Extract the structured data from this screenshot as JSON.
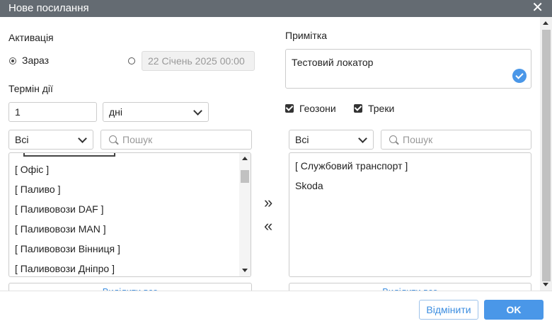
{
  "dialog": {
    "title": "Нове посилання",
    "close_glyph": "✕"
  },
  "activation": {
    "label": "Активація",
    "now_label": "Зараз",
    "date_value": "22 Січень 2025 00:00"
  },
  "term": {
    "label": "Термін дії",
    "value": "1",
    "unit": "дні"
  },
  "note": {
    "label": "Примітка",
    "value": "Тестовий локатор"
  },
  "options": {
    "geozones_label": "Геозони",
    "geozones_checked": true,
    "tracks_label": "Треки",
    "tracks_checked": true
  },
  "left_panel": {
    "filter": "Всі",
    "search_placeholder": "Пошук",
    "items": [
      "[ Офіс ]",
      "[ Паливо ]",
      "[ Паливовози DAF ]",
      "[ Паливовози MAN ]",
      "[ Паливовози Вінниця ]",
      "[ Паливовози Дніпро ]"
    ],
    "select_all": "Виділити все"
  },
  "right_panel": {
    "filter": "Всі",
    "search_placeholder": "Пошук",
    "items": [
      "[ Службовий транспорт ]",
      "Skoda"
    ],
    "select_all": "Виділити все"
  },
  "transfer": {
    "add": "»",
    "remove": "«"
  },
  "footer": {
    "cancel": "Відмінити",
    "ok": "OK"
  },
  "colors": {
    "titlebar": "#646b72",
    "accent": "#4a97e8"
  }
}
